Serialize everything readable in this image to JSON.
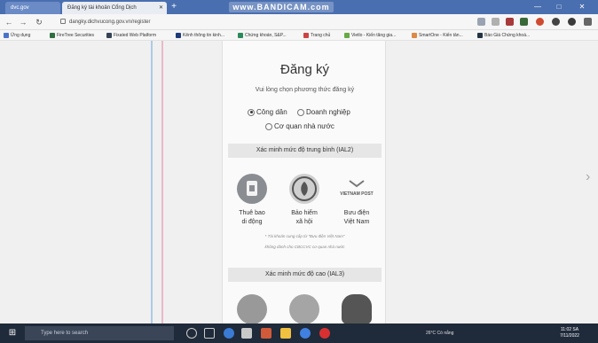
{
  "browser": {
    "tabs": [
      {
        "label": "dvc.gov"
      },
      {
        "label": "Đăng ký tài khoản Cổng Dịch"
      }
    ],
    "watermark": "www.BANDICAM.com",
    "address": "dangky.dichvucong.gov.vn/register",
    "bookmarks": [
      "Ứng dụng",
      "FireTree Securities",
      "Fixated Web Platform",
      "Kênh thông tin kinh...",
      "Chứng khoán, S&P...",
      "Trang chủ",
      "Vietlo - Kiến tăng gia...",
      "SmartOne - Kiến tản...",
      "Báo Giá Chứng khoá..."
    ]
  },
  "page": {
    "title": "Đăng ký",
    "subtitle": "Vui lòng chọn phương thức đăng ký",
    "account_types": [
      {
        "label": "Công dân",
        "selected": true
      },
      {
        "label": "Doanh nghiệp",
        "selected": false
      },
      {
        "label": "Cơ quan nhà nước",
        "selected": false
      }
    ],
    "section_medium": "Xác minh mức độ trung bình (IAL2)",
    "methods": [
      {
        "line1": "Thuê bao",
        "line2": "di động",
        "icon": "sim-card-icon",
        "color": "#8a8d92"
      },
      {
        "line1": "Bảo hiểm",
        "line2": "xã hội",
        "icon": "social-insurance-icon",
        "color": "#cfcfcf"
      },
      {
        "line1": "Bưu điện",
        "line2": "Việt Nam",
        "icon": "vietnam-post-icon",
        "logo_text": "VIETNAM POST"
      }
    ],
    "note_line1": "* Tài khoản cung cấp từ \"Bưu điện Việt Nam\"",
    "note_line2": "không dành cho CBCCVC cơ quan nhà nước",
    "section_high": "Xác minh mức độ cao (IAL3)"
  },
  "taskbar": {
    "search_placeholder": "Type here to search",
    "weather": "26°C Có nắng",
    "clock_time": "11:02 SA",
    "clock_date": "7/11/2022"
  },
  "colors": {
    "titlebar": "#4a6fb0",
    "taskbar": "#1f2a3a",
    "section_bg": "#e6e6e6"
  }
}
